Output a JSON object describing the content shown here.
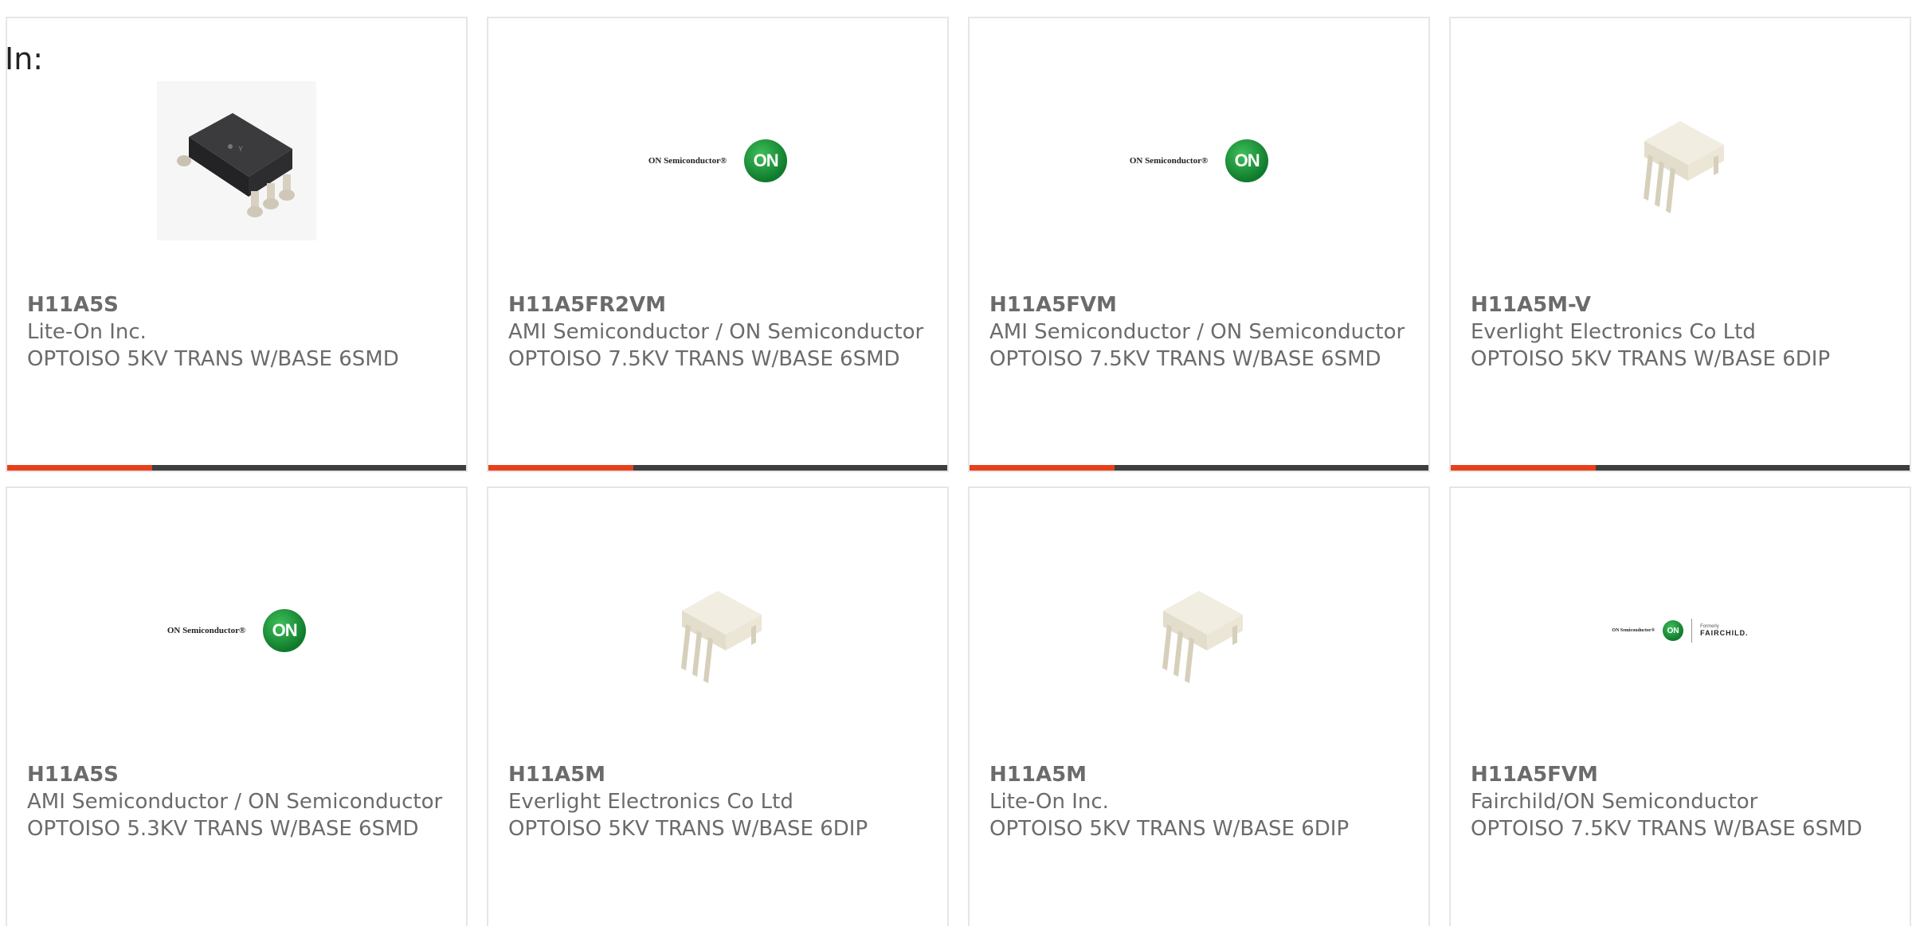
{
  "page": {
    "prefix_label": "In:"
  },
  "colors": {
    "accent": "#e8401c",
    "bar": "#3f3f3f",
    "card_border": "#e6e6e6",
    "text": "#6b6b6b"
  },
  "products": [
    {
      "part_number": "H11A5S",
      "manufacturer": "Lite-On Inc.",
      "description": "OPTOISO 5KV TRANS W/BASE 6SMD",
      "image": "smd-chip-black-icon",
      "show_accent_bar": true
    },
    {
      "part_number": "H11A5FR2VM",
      "manufacturer": "AMI Semiconductor / ON Semiconductor",
      "description": "OPTOISO 7.5KV TRANS W/BASE 6SMD",
      "image": "on-semiconductor-logo",
      "logo_text": "ON Semiconductor®",
      "logo_badge": "ON",
      "show_accent_bar": true
    },
    {
      "part_number": "H11A5FVM",
      "manufacturer": "AMI Semiconductor / ON Semiconductor",
      "description": "OPTOISO 7.5KV TRANS W/BASE 6SMD",
      "image": "on-semiconductor-logo",
      "logo_text": "ON Semiconductor®",
      "logo_badge": "ON",
      "show_accent_bar": true
    },
    {
      "part_number": "H11A5M-V",
      "manufacturer": "Everlight Electronics Co Ltd",
      "description": "OPTOISO 5KV TRANS W/BASE 6DIP",
      "image": "dip-chip-white-icon",
      "show_accent_bar": true
    },
    {
      "part_number": "H11A5S",
      "manufacturer": "AMI Semiconductor / ON Semiconductor",
      "description": "OPTOISO 5.3KV TRANS W/BASE 6SMD",
      "image": "on-semiconductor-logo",
      "logo_text": "ON Semiconductor®",
      "logo_badge": "ON",
      "show_accent_bar": false
    },
    {
      "part_number": "H11A5M",
      "manufacturer": "Everlight Electronics Co Ltd",
      "description": "OPTOISO 5KV TRANS W/BASE 6DIP",
      "image": "dip-chip-white-icon",
      "show_accent_bar": false
    },
    {
      "part_number": "H11A5M",
      "manufacturer": "Lite-On Inc.",
      "description": "OPTOISO 5KV TRANS W/BASE 6DIP",
      "image": "dip-chip-white-icon",
      "show_accent_bar": false
    },
    {
      "part_number": "H11A5FVM",
      "manufacturer": "Fairchild/ON Semiconductor",
      "description": "OPTOISO 7.5KV TRANS W/BASE 6SMD",
      "image": "on-fairchild-logo",
      "logo_text": "ON Semiconductor®",
      "logo_badge": "ON",
      "fc_small": "Formerly",
      "fc_name": "FAIRCHILD.",
      "show_accent_bar": false
    }
  ]
}
